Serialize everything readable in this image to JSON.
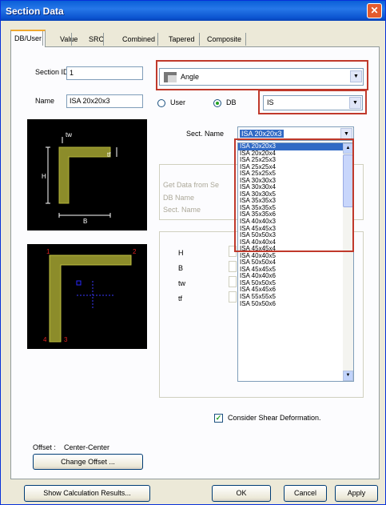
{
  "window": {
    "title": "Section Data",
    "close_glyph": "✕"
  },
  "tabs": [
    {
      "label": "DB/User",
      "active": true
    },
    {
      "label": "Value"
    },
    {
      "label": "SRC"
    },
    {
      "label": "Combined"
    },
    {
      "label": "Tapered"
    },
    {
      "label": "Composite"
    }
  ],
  "form": {
    "section_id_label": "Section ID",
    "section_id_value": "1",
    "name_label": "Name",
    "name_value": "ISA 20x20x3",
    "shape_value": "Angle",
    "user_label": "User",
    "db_label": "DB",
    "db_value": "IS",
    "sect_name_label": "Sect. Name",
    "sect_name_value": "ISA 20x20x3",
    "get_data_label": "Get Data from Se",
    "db_name_label": "DB Name",
    "sect_name_label2": "Sect. Name",
    "dim_labels": [
      "H",
      "B",
      "tw",
      "tf"
    ]
  },
  "section_list": [
    "ISA 20x20x3",
    "ISA 20x20x4",
    "ISA 25x25x3",
    "ISA 25x25x4",
    "ISA 25x25x5",
    "ISA 30x30x3",
    "ISA 30x30x4",
    "ISA 30x30x5",
    "ISA 35x35x3",
    "ISA 35x35x5",
    "ISA 35x35x6",
    "ISA 40x40x3",
    "ISA 45x45x3",
    "ISA 50x50x3",
    "ISA 40x40x4",
    "ISA 45x45x4",
    "ISA 40x40x5",
    "ISA 50x50x4",
    "ISA 45x45x5",
    "ISA 40x40x6",
    "ISA 50x50x5",
    "ISA 45x45x6",
    "ISA 55x55x5",
    "ISA 50x50x6"
  ],
  "diagram1_labels": {
    "tf": "tf",
    "tw": "tw",
    "h": "H",
    "b": "B"
  },
  "diagram2_labels": {
    "n1": "1",
    "n2": "2",
    "n3": "3",
    "n4": "4"
  },
  "shear_label": "Consider Shear Deformation.",
  "offset": {
    "label": "Offset :",
    "value": "Center-Center",
    "button": "Change Offset ..."
  },
  "footer": {
    "calc": "Show Calculation Results...",
    "ok": "OK",
    "cancel": "Cancel",
    "apply": "Apply"
  },
  "colors": {
    "selection": "#316ac5",
    "highlight_box": "#c0392b",
    "section_fill": "#8c8c2a"
  }
}
